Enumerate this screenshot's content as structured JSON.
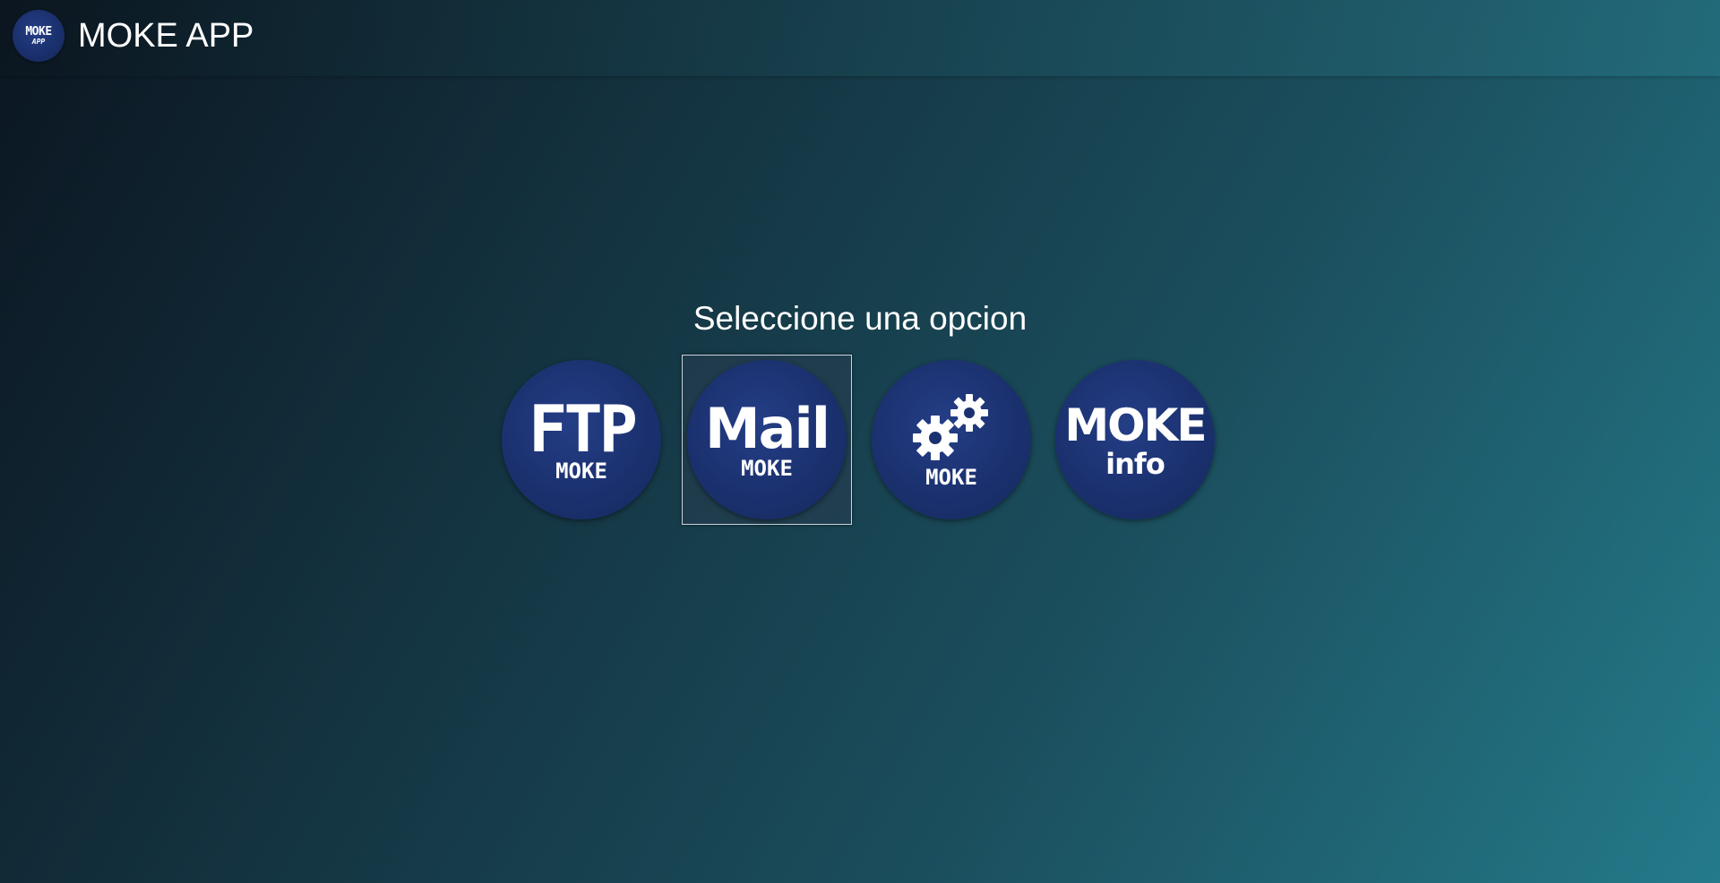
{
  "header": {
    "logo": {
      "line1": "MOKE",
      "line2": "APP"
    },
    "title": "MOKE APP"
  },
  "main": {
    "prompt": "Seleccione una opcion",
    "options": [
      {
        "id": "ftp",
        "big": "FTP",
        "small": "MOKE",
        "icon": "ftp-icon"
      },
      {
        "id": "mail",
        "big": "Mail",
        "small": "MOKE",
        "icon": "mail-icon",
        "selected": true
      },
      {
        "id": "settings",
        "big": "",
        "small": "MOKE",
        "icon": "gears-icon"
      },
      {
        "id": "info",
        "big": "MOKE",
        "small": "info",
        "icon": "info-icon"
      }
    ]
  },
  "colors": {
    "disc": "#1b316f",
    "text": "#ffffff",
    "selection_border": "#c9d4dc"
  }
}
